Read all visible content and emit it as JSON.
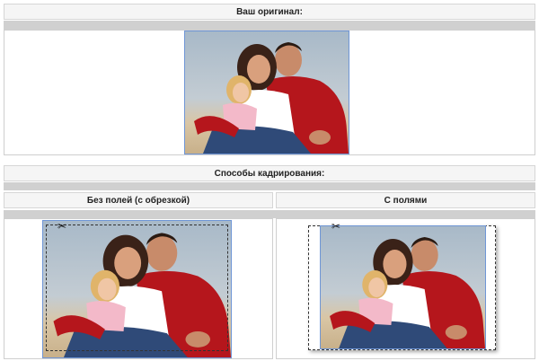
{
  "sections": {
    "original_title": "Ваш оригинал:",
    "methods_title": "Способы кадрирования:",
    "no_margins_title": "Без полей (с обрезкой)",
    "with_margins_title": "С полями"
  },
  "icons": {
    "scissors": "scissors-icon"
  },
  "colors": {
    "frame_blue": "#6f96d6",
    "header_bg": "#f5f5f5",
    "bar_gray": "#d0d0d0"
  }
}
